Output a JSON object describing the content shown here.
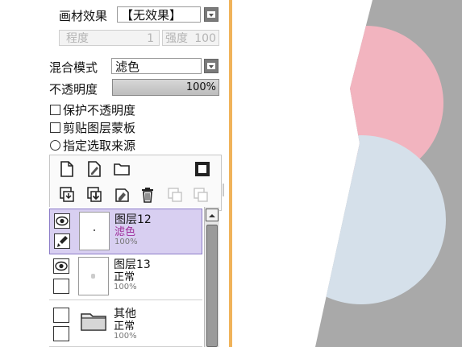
{
  "texture": {
    "label": "画材效果",
    "value": "【无效果】"
  },
  "degree": {
    "label": "程度",
    "value": "1"
  },
  "strength": {
    "label": "强度",
    "value": "100"
  },
  "blend": {
    "label": "混合模式",
    "value": "滤色"
  },
  "opacity": {
    "label": "不透明度",
    "value": "100%"
  },
  "options": {
    "protect_alpha": "保护不透明度",
    "clip_mask": "剪贴图层蒙板",
    "selection_source": "指定选取来源"
  },
  "layers": [
    {
      "name": "图层12",
      "mode": "滤色",
      "opacity": "100%",
      "selected": true
    },
    {
      "name": "图层13",
      "mode": "正常",
      "opacity": "100%",
      "selected": false
    },
    {
      "name": "其他",
      "mode": "正常",
      "opacity": "100%",
      "selected": false
    }
  ],
  "colors": {
    "pink_circle": "#f2b4bf",
    "blue_circle": "#d5e0ea",
    "gray_bg": "#a9a9a9",
    "selected_mode_text": "#a0309c",
    "accent_line": "#f0b35a"
  }
}
